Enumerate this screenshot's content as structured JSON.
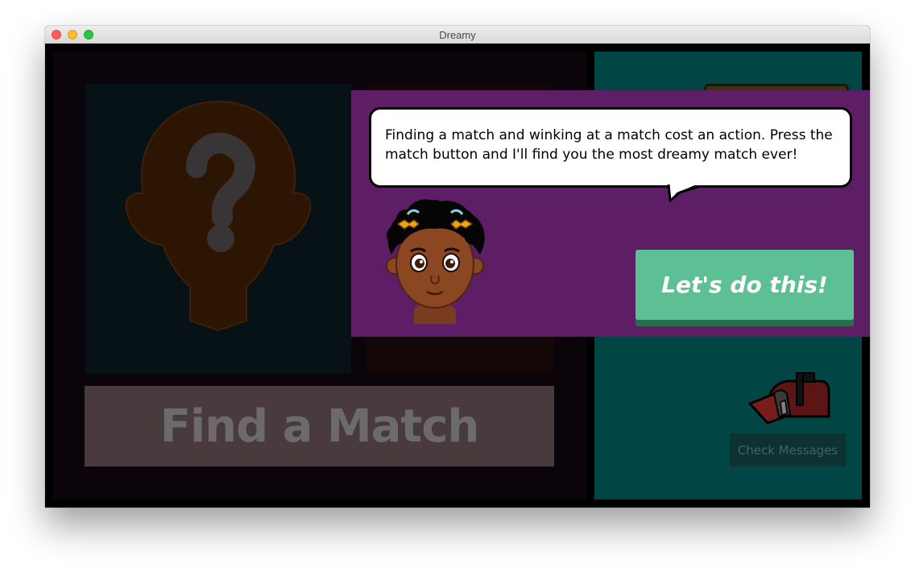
{
  "window": {
    "title": "Dreamy"
  },
  "game": {
    "find_match_label": "Find a Match",
    "check_messages_label": "Check Messages",
    "placeholder_mark": "?"
  },
  "tutorial": {
    "message": "Finding a match and winking at a match cost an action. Press the match button and I'll find you the most dreamy match ever!",
    "cta_label": "Let's do this!"
  },
  "icons": {
    "unknown_profile": "silhouette-question-icon",
    "mailbox": "mailbox-icon",
    "guide": "guide-avatar"
  },
  "colors": {
    "tutorial_banner": "#5d1e66",
    "cta_button": "#5dc095",
    "right_panel": "#024545",
    "find_match_button": "#493a3d"
  }
}
